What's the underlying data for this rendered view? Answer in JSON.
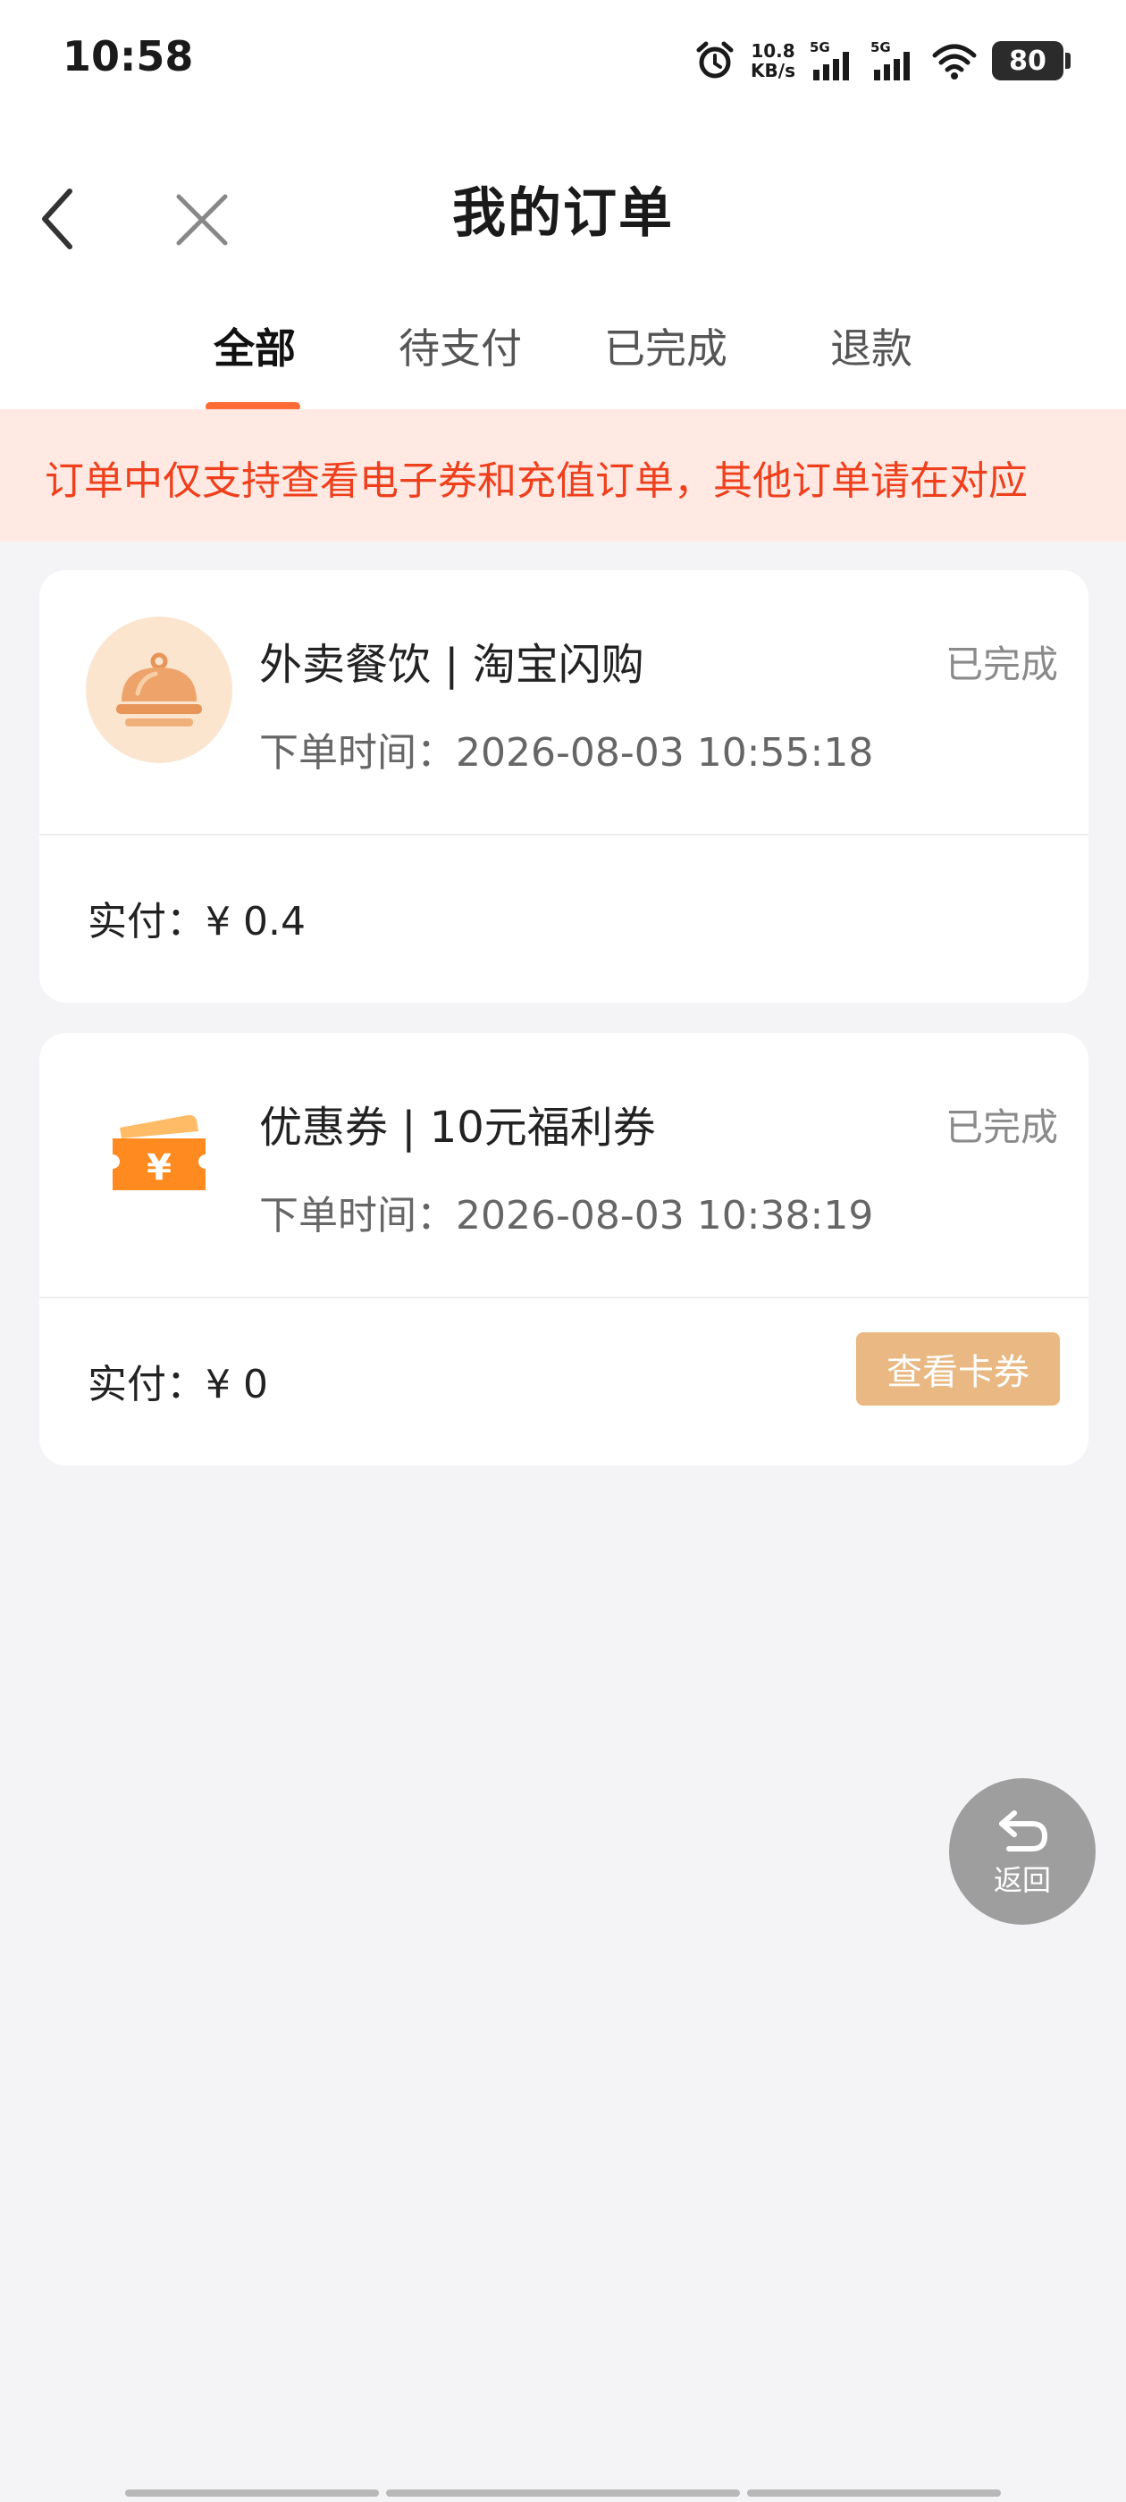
{
  "status_bar": {
    "time": "10:58",
    "net_speed_value": "10.8",
    "net_speed_unit": "KB/s",
    "signal_1": "5G",
    "signal_2": "5G",
    "battery": "80",
    "icons": [
      "alarm-icon",
      "signal-icon",
      "signal-icon",
      "wifi-icon",
      "battery-icon"
    ]
  },
  "header": {
    "title": "我的订单",
    "back_icon": "chevron-left-icon",
    "close_icon": "close-icon"
  },
  "tabs": [
    {
      "label": "全部",
      "active": true
    },
    {
      "label": "待支付",
      "active": false
    },
    {
      "label": "已完成",
      "active": false
    },
    {
      "label": "退款",
      "active": false
    }
  ],
  "notice": {
    "text": "订单中仅支持查看电子券和充值订单，其他订单请在对应"
  },
  "orders": [
    {
      "icon": "food-cloche-icon",
      "title": "外卖餐饮 | 淘宝闪购",
      "time_label": "下单时间：",
      "time": "2026-08-03 10:55:18",
      "status": "已完成",
      "paid_label": "实付：",
      "paid": "¥  0.4"
    },
    {
      "icon": "coupon-icon",
      "title": "优惠券 | 10元福利券",
      "time_label": "下单时间：",
      "time": "2026-08-03 10:38:19",
      "status": "已完成",
      "paid_label": "实付：",
      "paid": "¥  0",
      "action": "查看卡券"
    }
  ],
  "float_button": {
    "label": "返回",
    "icon": "return-arrow-icon"
  },
  "colors": {
    "accent": "#ff6a35",
    "notice_text": "#ef3f1c",
    "notice_bg": "#ffe9e2",
    "button_bg": "#e9b883"
  }
}
